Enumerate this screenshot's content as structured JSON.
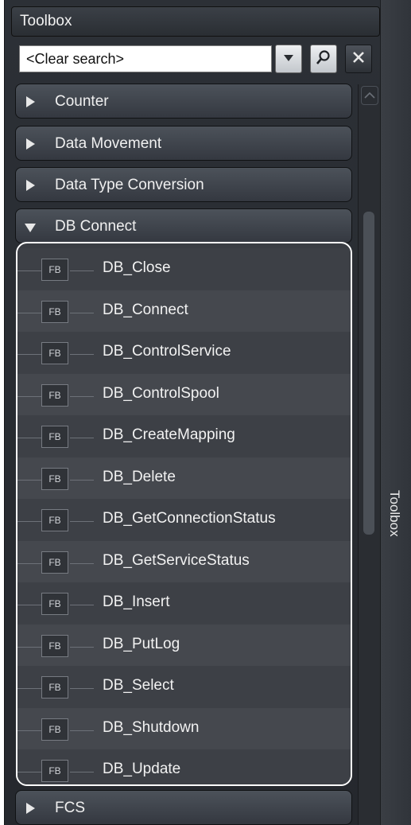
{
  "toolbox": {
    "title": "Toolbox",
    "search_value": "<Clear search>",
    "side_tab_label": "Toolbox"
  },
  "categories": [
    {
      "label": "Counter",
      "expanded": false
    },
    {
      "label": "Data Movement",
      "expanded": false
    },
    {
      "label": "Data Type Conversion",
      "expanded": false
    },
    {
      "label": "DB Connect",
      "expanded": true
    },
    {
      "label": "FCS",
      "expanded": false
    }
  ],
  "block_badge": "FB",
  "db_connect_items": [
    "DB_Close",
    "DB_Connect",
    "DB_ControlService",
    "DB_ControlSpool",
    "DB_CreateMapping",
    "DB_Delete",
    "DB_GetConnectionStatus",
    "DB_GetServiceStatus",
    "DB_Insert",
    "DB_PutLog",
    "DB_Select",
    "DB_Shutdown",
    "DB_Update"
  ],
  "icons": {
    "dropdown": "chevron-down-icon",
    "search": "search-icon",
    "clear": "close-icon"
  }
}
